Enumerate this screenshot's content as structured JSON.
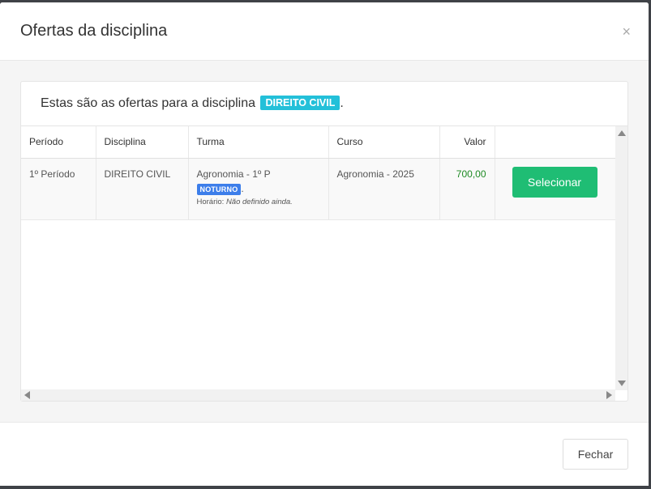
{
  "modal": {
    "title": "Ofertas da disciplina",
    "close_label": "×"
  },
  "card": {
    "intro": "Estas são as ofertas para a disciplina",
    "discipline": "DIREITO CIVIL",
    "suffix": "."
  },
  "table": {
    "headers": {
      "periodo": "Período",
      "disciplina": "Disciplina",
      "turma": "Turma",
      "curso": "Curso",
      "valor": "Valor"
    },
    "rows": [
      {
        "periodo": "1º Período",
        "disciplina": "DIREITO CIVIL",
        "turma": "Agronomia - 1º P",
        "turno": "NOTURNO",
        "turno_suffix": ".",
        "horario_label": "Horário:",
        "horario_value": "Não definido ainda.",
        "curso": "Agronomia - 2025",
        "valor": "700,00",
        "action_label": "Selecionar"
      }
    ]
  },
  "footer": {
    "close_button": "Fechar"
  },
  "colors": {
    "discipline_badge": "#23c0d9",
    "turno_badge": "#3d7eea",
    "select_button": "#1fbd74",
    "valor_text": "#1e8a24"
  }
}
